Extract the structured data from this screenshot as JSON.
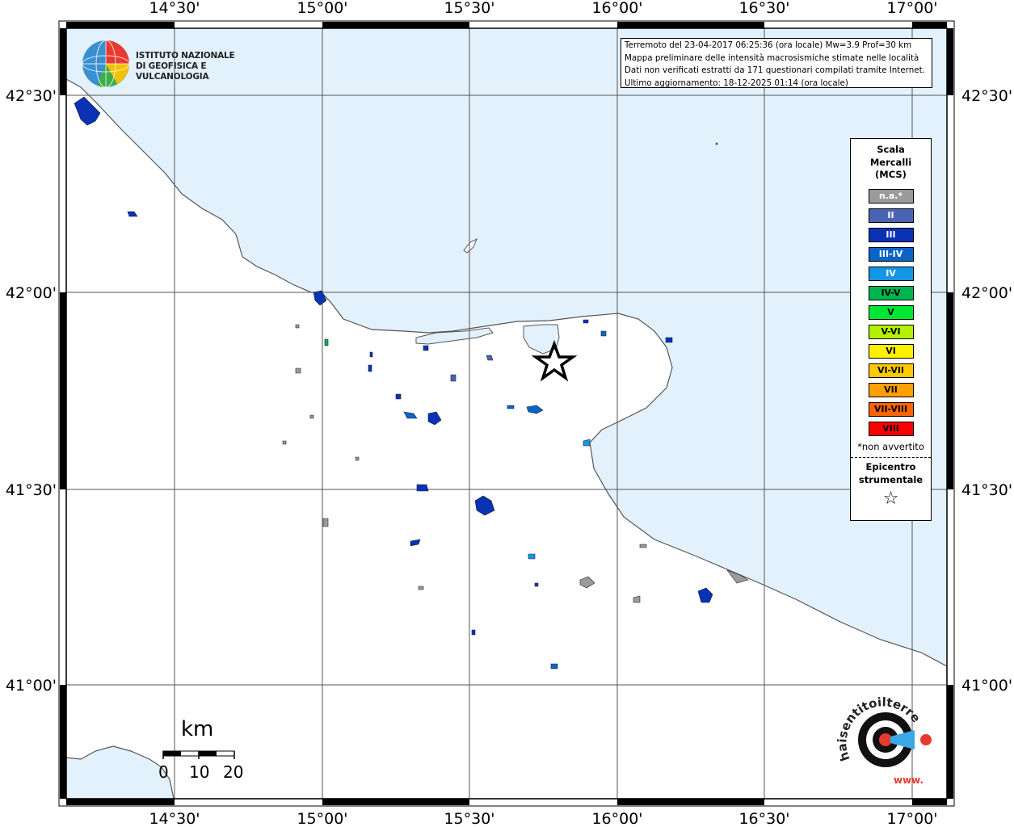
{
  "info": {
    "line1": "Terremoto del 23-04-2017 06:25:36 (ora locale) Mw=3.9 Prof=30 km",
    "line2": "Mappa preliminare delle intensità macrosismiche stimate nelle località",
    "line3": "Dati non verificati estratti da 171 questionari compilati tramite Internet.",
    "line4": "Ultimo aggiornamento: 18-12-2025 01:14 (ora locale)"
  },
  "ingv": {
    "line1": "ISTITUTO NAZIONALE",
    "line2": "DI GEOFISICA E VULCANOLOGIA"
  },
  "axes": {
    "top_labels": [
      "14°30'",
      "15°00'",
      "15°30'",
      "16°00'",
      "16°30'",
      "17°00'"
    ],
    "bottom_labels": [
      "14°30'",
      "15°00'",
      "15°30'",
      "16°00'",
      "16°30'",
      "17°00'"
    ],
    "left_labels": [
      "42°30'",
      "42°00'",
      "41°30'",
      "41°00'"
    ],
    "right_labels": [
      "42°30'",
      "42°00'",
      "41°30'",
      "41°00'"
    ]
  },
  "legend": {
    "title1": "Scala",
    "title2": "Mercalli",
    "title3": "(MCS)",
    "items": [
      {
        "label": "n.a.*",
        "color": "#9a9a9a",
        "text_color": "#ffffff"
      },
      {
        "label": "II",
        "color": "#4a64b4",
        "text_color": "#ffffff"
      },
      {
        "label": "III",
        "color": "#0a32b4",
        "text_color": "#ffffff"
      },
      {
        "label": "III-IV",
        "color": "#0a64c8",
        "text_color": "#ffffff"
      },
      {
        "label": "IV",
        "color": "#1496e6",
        "text_color": "#ffffff"
      },
      {
        "label": "IV-V",
        "color": "#00b450",
        "text_color": "#000000"
      },
      {
        "label": "V",
        "color": "#00e632",
        "text_color": "#000000"
      },
      {
        "label": "V-VI",
        "color": "#b4f000",
        "text_color": "#000000"
      },
      {
        "label": "VI",
        "color": "#fff000",
        "text_color": "#000000"
      },
      {
        "label": "VI-VII",
        "color": "#ffc800",
        "text_color": "#000000"
      },
      {
        "label": "VII",
        "color": "#ffa000",
        "text_color": "#000000"
      },
      {
        "label": "VII-VIII",
        "color": "#ff6400",
        "text_color": "#000000"
      },
      {
        "label": "VIII",
        "color": "#ff0000",
        "text_color": "#000000"
      }
    ],
    "note": "*non avvertito",
    "epi1": "Epicentro",
    "epi2": "strumentale",
    "star": "☆"
  },
  "scale": {
    "unit": "km",
    "labels": [
      "0",
      "10",
      "20"
    ]
  },
  "hst": {
    "text": "haisentitoilterremoto.it",
    "url": "www."
  },
  "colors": {
    "sea": "#e3f1fd",
    "land": "#ffffff",
    "coast": "#555555"
  }
}
